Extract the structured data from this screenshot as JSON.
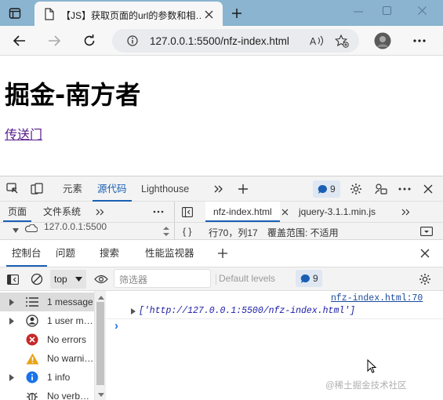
{
  "browser": {
    "tab_title": "【JS】获取页面的url的参数和相…",
    "address": "127.0.0.1:5500/nfz-index.html"
  },
  "page": {
    "heading": "掘金-南方者",
    "link": "传送门"
  },
  "devtools": {
    "tabs": [
      "元素",
      "源代码",
      "Lighthouse"
    ],
    "issues_count": "9",
    "sources": {
      "left_tabs": [
        "页面",
        "文件系统"
      ],
      "file_tabs": [
        "nfz-index.html",
        "jquery-3.1.1.min.js"
      ],
      "tree_item": "127.0.0.1:5500",
      "status_braces": "{ }",
      "position": "行70，列17",
      "coverage": "覆盖范围: 不适用"
    },
    "drawer_tabs": [
      "控制台",
      "问题",
      "搜索",
      "性能监视器"
    ],
    "console": {
      "context": "top",
      "filter_placeholder": "筛选器",
      "levels": "Default levels",
      "issues_count": "9",
      "sidebar": [
        {
          "label": "1 message",
          "icon": "list-icon"
        },
        {
          "label": "1 user m…",
          "icon": "user-icon"
        },
        {
          "label": "No errors",
          "icon": "error-icon"
        },
        {
          "label": "No warni…",
          "icon": "warning-icon"
        },
        {
          "label": "1 info",
          "icon": "info-icon"
        },
        {
          "label": "No verb…",
          "icon": "bug-icon"
        }
      ],
      "source_link": "nfz-index.html:70",
      "log_value": "['http://127.0.0.1:5500/nfz-index.html']",
      "prompt": "›"
    }
  },
  "watermark": "@稀土掘金技术社区",
  "colors": {
    "accent": "#1a5fb4",
    "titlebar": "#8ab4cf",
    "error": "#c62828",
    "warning": "#e8a317",
    "info": "#1a73e8",
    "visited_link": "#551a8b"
  }
}
